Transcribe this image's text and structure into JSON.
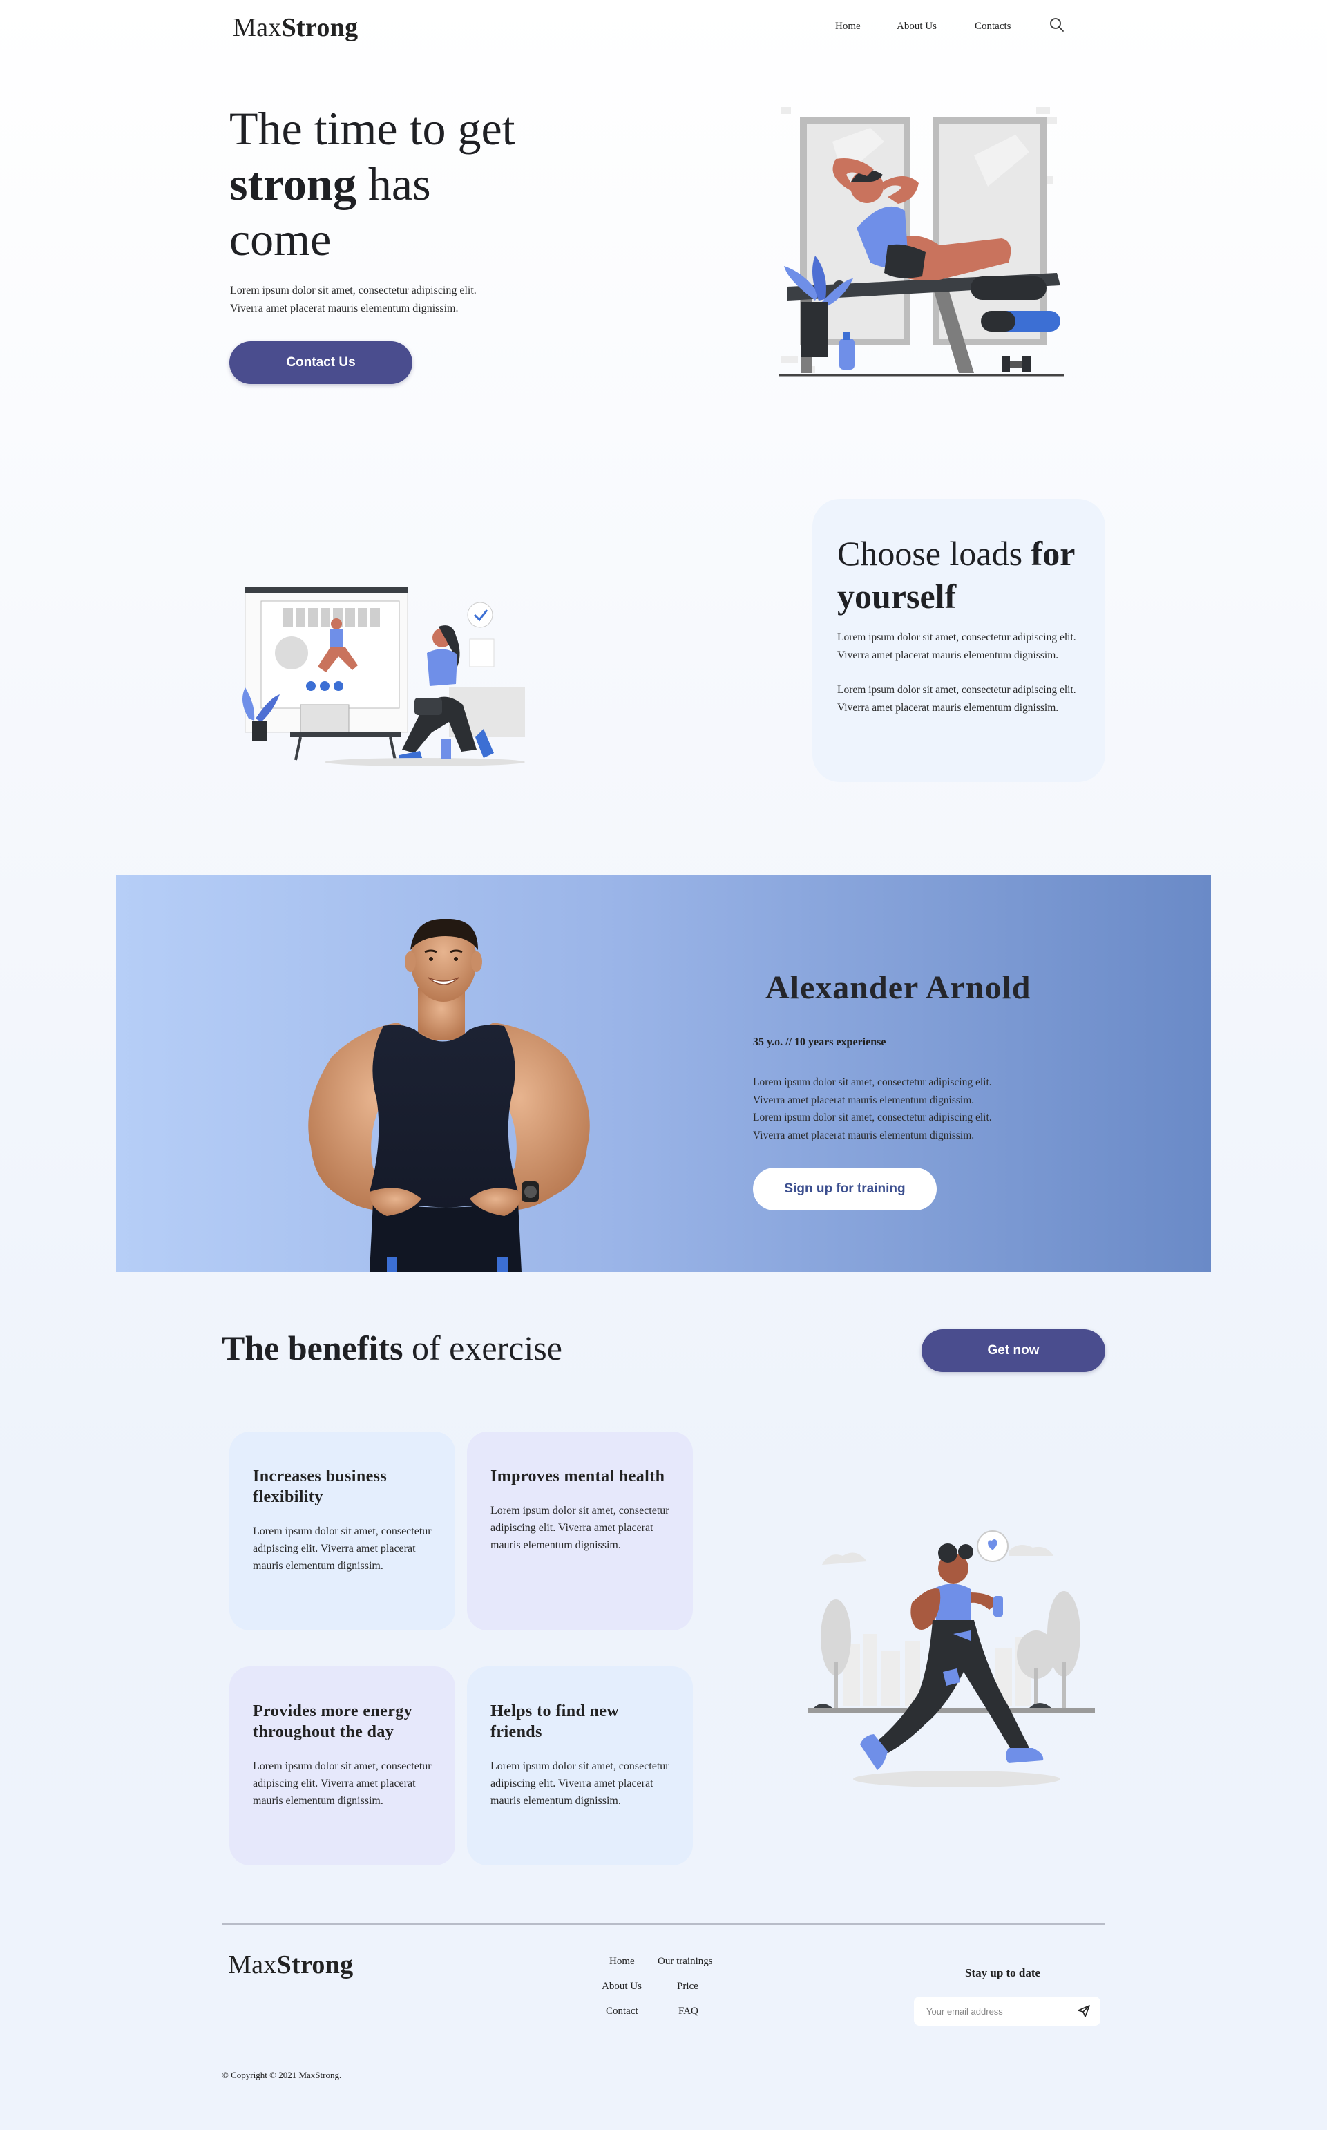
{
  "header": {
    "logo_light": "Max",
    "logo_bold": "Strong",
    "nav": [
      "Home",
      "About Us",
      "Contacts"
    ]
  },
  "hero": {
    "title_line1": "The time to get",
    "title_bold": "strong",
    "title_rest": " has",
    "title_line3": "come",
    "text_line1": "Lorem ipsum dolor sit amet, consectetur adipiscing elit.",
    "text_line2": "Viverra amet placerat mauris elementum dignissim.",
    "button": "Contact Us"
  },
  "choose": {
    "title_light": "Choose loads ",
    "title_bold1": "for",
    "title_bold2": "yourself",
    "text": "Lorem ipsum dolor sit amet, consectetur adipiscing elit. Viverra amet placerat mauris elementum dignissim.",
    "text2": "Lorem ipsum dolor sit amet, consectetur adipiscing elit. Viverra amet placerat mauris elementum dignissim."
  },
  "trainer": {
    "name": "Alexander Arnold",
    "meta": "35 y.o. // 10 years experiense",
    "lines": [
      "Lorem ipsum dolor sit amet, consectetur adipiscing elit.",
      "Viverra amet placerat mauris elementum dignissim.",
      "Lorem ipsum dolor sit amet, consectetur adipiscing elit.",
      "Viverra amet placerat mauris elementum dignissim."
    ],
    "button": "Sign up for training"
  },
  "benefits": {
    "title_bold": "The benefits",
    "title_rest": " of exercise",
    "button": "Get now",
    "cards": [
      {
        "title": "Increases business flexibility",
        "text": "Lorem ipsum dolor sit amet, consectetur adipiscing elit. Viverra amet placerat mauris elementum dignissim."
      },
      {
        "title": "Improves mental health",
        "text": "Lorem ipsum dolor sit amet, consectetur adipiscing elit. Viverra amet placerat mauris elementum dignissim."
      },
      {
        "title": "Provides more energy throughout the day",
        "text": "Lorem ipsum dolor sit amet, consectetur adipiscing elit. Viverra amet placerat mauris elementum dignissim."
      },
      {
        "title": "Helps to find new friends",
        "text": "Lorem ipsum dolor sit amet, consectetur adipiscing elit. Viverra amet placerat mauris elementum dignissim."
      }
    ]
  },
  "footer": {
    "logo_light": "Max",
    "logo_bold": "Strong",
    "links": [
      "Home",
      "Our trainings",
      "About Us",
      "Price",
      "Contact",
      "FAQ"
    ],
    "stay_title": "Stay up to date",
    "email_placeholder": "Your email address",
    "copyright": "© Copyright © 2021 MaxStrong."
  },
  "colors": {
    "primary_button": "#4a4d8e",
    "banner_start": "#b6cef7",
    "banner_end": "#6a8ac7",
    "card_blue": "#e4eefd",
    "card_lavender": "#e6e8fb",
    "illustration_blue": "#6f8fe8",
    "illustration_terracotta": "#c9735d"
  }
}
